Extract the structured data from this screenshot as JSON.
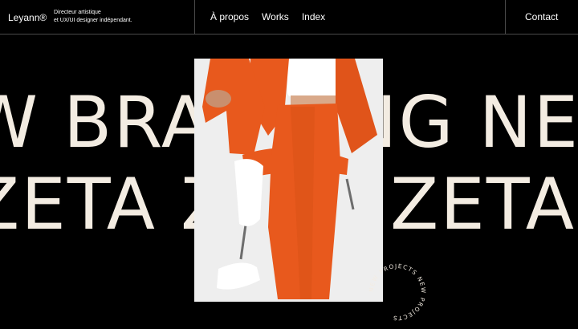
{
  "header": {
    "brand": "Leyann®",
    "tagline_line1": "Directeur artistique",
    "tagline_line2": "et UX/UI designer indépendant.",
    "nav": [
      "À propos",
      "Works",
      "Index"
    ],
    "contact": "Contact"
  },
  "hero": {
    "line1": "W BRANDING NEW BRANDING NE",
    "line2": "ZETA ZETA ZETA ZETA ZETA"
  },
  "badge": {
    "text": "NEW PROJECTS NEW PROJECTS "
  },
  "colors": {
    "background": "#000000",
    "text": "#f3ece2",
    "accent_orange": "#e8591d",
    "divider": "#4a4a4a"
  }
}
